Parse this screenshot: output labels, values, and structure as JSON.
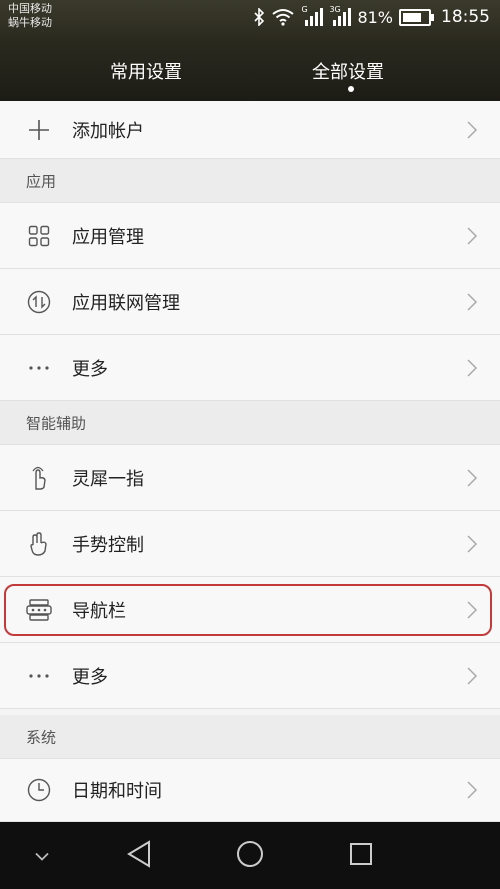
{
  "status_bar": {
    "carrier_1": "中国移动",
    "carrier_2": "蜗牛移动",
    "net_g": "G",
    "net_3g": "3G",
    "battery_text": "81%",
    "time": "18:55",
    "battery_level": 0.81
  },
  "tabs": [
    {
      "label": "常用设置",
      "active": false
    },
    {
      "label": "全部设置",
      "active": true
    }
  ],
  "list": {
    "add_account": "添加帐户",
    "section_apps": "应用",
    "app_manage": "应用管理",
    "app_network": "应用联网管理",
    "more_1": "更多",
    "section_assist": "智能辅助",
    "knuckle": "灵犀一指",
    "gesture": "手势控制",
    "navbar": "导航栏",
    "more_2": "更多",
    "section_system": "系统",
    "datetime": "日期和时间"
  },
  "colors": {
    "highlight": "#c23a3a"
  },
  "icons": {
    "add": "plus-icon",
    "apps": "grid-icon",
    "network": "network-arrows-icon",
    "more": "dots-icon",
    "knuckle": "knuckle-icon",
    "gesture": "gesture-hand-icon",
    "navbar": "navigation-bar-icon",
    "clock": "clock-icon"
  }
}
